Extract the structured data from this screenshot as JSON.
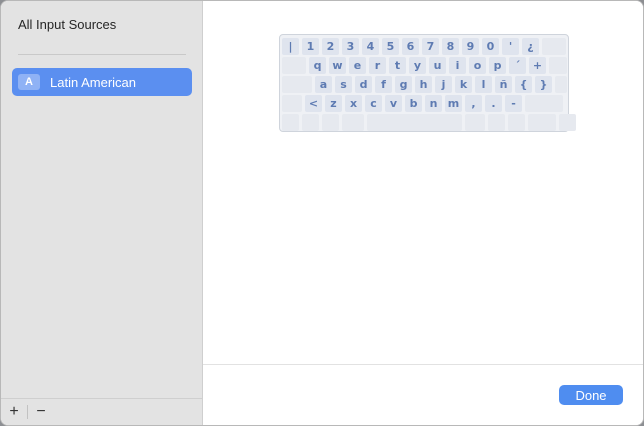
{
  "sidebar": {
    "title": "All Input Sources",
    "items": [
      {
        "icon_letter": "A",
        "label": "Latin American",
        "selected": true
      }
    ],
    "add_label": "+",
    "remove_label": "−"
  },
  "keyboard": {
    "rows": [
      [
        "|",
        "1",
        "2",
        "3",
        "4",
        "5",
        "6",
        "7",
        "8",
        "9",
        "0",
        "'",
        "¿",
        ""
      ],
      [
        "",
        "q",
        "w",
        "e",
        "r",
        "t",
        "y",
        "u",
        "i",
        "o",
        "p",
        "´",
        "+",
        ""
      ],
      [
        "",
        "a",
        "s",
        "d",
        "f",
        "g",
        "h",
        "j",
        "k",
        "l",
        "ñ",
        "{",
        "}",
        ""
      ],
      [
        "",
        "<",
        "z",
        "x",
        "c",
        "v",
        "b",
        "n",
        "m",
        ",",
        ".",
        "-",
        ""
      ],
      [
        "",
        "",
        "",
        "",
        "",
        "",
        "",
        "",
        "",
        ""
      ]
    ]
  },
  "footer": {
    "done_label": "Done"
  },
  "colors": {
    "accent": "#5b8ff0",
    "key_text": "#5e7bb2"
  }
}
